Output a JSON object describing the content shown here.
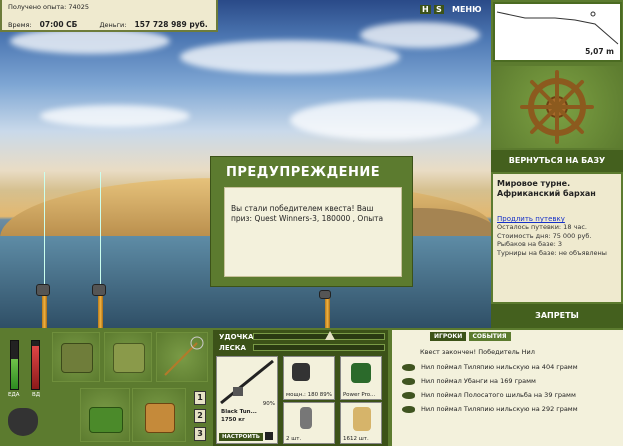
{
  "hud": {
    "xp_label": "Получено опыта: 74025",
    "time_label": "Время:",
    "time_value": "07:00 СБ",
    "money_label": "Деньги:",
    "money_value": "157 728 989 руб."
  },
  "top_buttons": {
    "help": "H",
    "sound": "S",
    "menu": "МЕНЮ"
  },
  "depth": {
    "value": "5,07 m"
  },
  "right_panel": {
    "back_button": "ВЕРНУТЬСЯ НА БАЗУ",
    "tour_title": "Мировое турне. Африканский бархан",
    "extend_link": "Продлить путевку",
    "stats": [
      "Осталось путевки: 18 час.",
      "Стоимость дня: 75 000 руб.",
      "Рыбаков на базе: 3",
      "Турниры на базе: не объявлены"
    ],
    "ban_button": "ЗАПРЕТЫ"
  },
  "dialog": {
    "title": "ПРЕДУПРЕЖДЕНИЕ",
    "message": "Вы стали победителем квеста! Ваш приз: Quest Winners-3, 180000 , Опыта"
  },
  "bars": {
    "food_label": "ЕДА",
    "health_label": "ВД",
    "food_level": 0.62,
    "health_level": 0.9
  },
  "inventory": {
    "slot_numbers": [
      "1",
      "2",
      "3"
    ]
  },
  "rod_panel": {
    "rod_label": "УДОЧКА",
    "line_label": "ЛЕСКА",
    "rod_name": "Black Tun...",
    "rod_weight": "1750 кг",
    "rod_percent": "90%",
    "setup_button": "НАСТРОИТЬ",
    "gear": [
      {
        "caption": "мощн.: 180",
        "extra": "89%"
      },
      {
        "caption": "Power Pro..."
      },
      {
        "caption": "2 шт."
      },
      {
        "caption": "1612 шт."
      }
    ]
  },
  "log": {
    "tabs": [
      "ИГРОКИ",
      "СОБЫТИЯ"
    ],
    "title": "Квест закончен! Победитель Нил",
    "entries": [
      "Нил поймал Тиляпию нильскую на 404 грамм",
      "Нил поймал Убанги на 169 грамм",
      "Нил поймал Полосатого шильба на 39 грамм",
      "Нил поймал Тиляпию нильскую на 292 грамм"
    ]
  }
}
